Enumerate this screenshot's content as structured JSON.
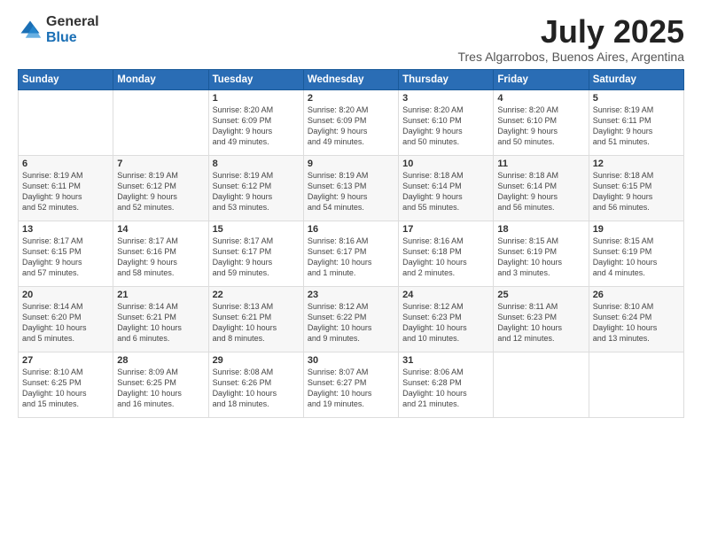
{
  "logo": {
    "general": "General",
    "blue": "Blue"
  },
  "title": "July 2025",
  "subtitle": "Tres Algarrobos, Buenos Aires, Argentina",
  "headers": [
    "Sunday",
    "Monday",
    "Tuesday",
    "Wednesday",
    "Thursday",
    "Friday",
    "Saturday"
  ],
  "weeks": [
    [
      {
        "day": "",
        "info": ""
      },
      {
        "day": "",
        "info": ""
      },
      {
        "day": "1",
        "info": "Sunrise: 8:20 AM\nSunset: 6:09 PM\nDaylight: 9 hours\nand 49 minutes."
      },
      {
        "day": "2",
        "info": "Sunrise: 8:20 AM\nSunset: 6:09 PM\nDaylight: 9 hours\nand 49 minutes."
      },
      {
        "day": "3",
        "info": "Sunrise: 8:20 AM\nSunset: 6:10 PM\nDaylight: 9 hours\nand 50 minutes."
      },
      {
        "day": "4",
        "info": "Sunrise: 8:20 AM\nSunset: 6:10 PM\nDaylight: 9 hours\nand 50 minutes."
      },
      {
        "day": "5",
        "info": "Sunrise: 8:19 AM\nSunset: 6:11 PM\nDaylight: 9 hours\nand 51 minutes."
      }
    ],
    [
      {
        "day": "6",
        "info": "Sunrise: 8:19 AM\nSunset: 6:11 PM\nDaylight: 9 hours\nand 52 minutes."
      },
      {
        "day": "7",
        "info": "Sunrise: 8:19 AM\nSunset: 6:12 PM\nDaylight: 9 hours\nand 52 minutes."
      },
      {
        "day": "8",
        "info": "Sunrise: 8:19 AM\nSunset: 6:12 PM\nDaylight: 9 hours\nand 53 minutes."
      },
      {
        "day": "9",
        "info": "Sunrise: 8:19 AM\nSunset: 6:13 PM\nDaylight: 9 hours\nand 54 minutes."
      },
      {
        "day": "10",
        "info": "Sunrise: 8:18 AM\nSunset: 6:14 PM\nDaylight: 9 hours\nand 55 minutes."
      },
      {
        "day": "11",
        "info": "Sunrise: 8:18 AM\nSunset: 6:14 PM\nDaylight: 9 hours\nand 56 minutes."
      },
      {
        "day": "12",
        "info": "Sunrise: 8:18 AM\nSunset: 6:15 PM\nDaylight: 9 hours\nand 56 minutes."
      }
    ],
    [
      {
        "day": "13",
        "info": "Sunrise: 8:17 AM\nSunset: 6:15 PM\nDaylight: 9 hours\nand 57 minutes."
      },
      {
        "day": "14",
        "info": "Sunrise: 8:17 AM\nSunset: 6:16 PM\nDaylight: 9 hours\nand 58 minutes."
      },
      {
        "day": "15",
        "info": "Sunrise: 8:17 AM\nSunset: 6:17 PM\nDaylight: 9 hours\nand 59 minutes."
      },
      {
        "day": "16",
        "info": "Sunrise: 8:16 AM\nSunset: 6:17 PM\nDaylight: 10 hours\nand 1 minute."
      },
      {
        "day": "17",
        "info": "Sunrise: 8:16 AM\nSunset: 6:18 PM\nDaylight: 10 hours\nand 2 minutes."
      },
      {
        "day": "18",
        "info": "Sunrise: 8:15 AM\nSunset: 6:19 PM\nDaylight: 10 hours\nand 3 minutes."
      },
      {
        "day": "19",
        "info": "Sunrise: 8:15 AM\nSunset: 6:19 PM\nDaylight: 10 hours\nand 4 minutes."
      }
    ],
    [
      {
        "day": "20",
        "info": "Sunrise: 8:14 AM\nSunset: 6:20 PM\nDaylight: 10 hours\nand 5 minutes."
      },
      {
        "day": "21",
        "info": "Sunrise: 8:14 AM\nSunset: 6:21 PM\nDaylight: 10 hours\nand 6 minutes."
      },
      {
        "day": "22",
        "info": "Sunrise: 8:13 AM\nSunset: 6:21 PM\nDaylight: 10 hours\nand 8 minutes."
      },
      {
        "day": "23",
        "info": "Sunrise: 8:12 AM\nSunset: 6:22 PM\nDaylight: 10 hours\nand 9 minutes."
      },
      {
        "day": "24",
        "info": "Sunrise: 8:12 AM\nSunset: 6:23 PM\nDaylight: 10 hours\nand 10 minutes."
      },
      {
        "day": "25",
        "info": "Sunrise: 8:11 AM\nSunset: 6:23 PM\nDaylight: 10 hours\nand 12 minutes."
      },
      {
        "day": "26",
        "info": "Sunrise: 8:10 AM\nSunset: 6:24 PM\nDaylight: 10 hours\nand 13 minutes."
      }
    ],
    [
      {
        "day": "27",
        "info": "Sunrise: 8:10 AM\nSunset: 6:25 PM\nDaylight: 10 hours\nand 15 minutes."
      },
      {
        "day": "28",
        "info": "Sunrise: 8:09 AM\nSunset: 6:25 PM\nDaylight: 10 hours\nand 16 minutes."
      },
      {
        "day": "29",
        "info": "Sunrise: 8:08 AM\nSunset: 6:26 PM\nDaylight: 10 hours\nand 18 minutes."
      },
      {
        "day": "30",
        "info": "Sunrise: 8:07 AM\nSunset: 6:27 PM\nDaylight: 10 hours\nand 19 minutes."
      },
      {
        "day": "31",
        "info": "Sunrise: 8:06 AM\nSunset: 6:28 PM\nDaylight: 10 hours\nand 21 minutes."
      },
      {
        "day": "",
        "info": ""
      },
      {
        "day": "",
        "info": ""
      }
    ]
  ]
}
